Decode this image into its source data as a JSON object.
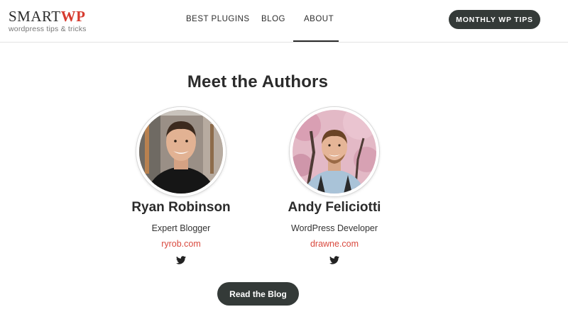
{
  "header": {
    "logo_main": "SMART",
    "logo_accent": "WP",
    "logo_tagline": "wordpress tips & tricks",
    "nav": [
      {
        "label": "BEST PLUGINS"
      },
      {
        "label": "BLOG"
      },
      {
        "label": "ABOUT"
      }
    ],
    "active_nav": "ABOUT",
    "tips_button": "MONTHLY WP TIPS"
  },
  "main": {
    "title": "Meet the Authors",
    "authors": [
      {
        "name": "Ryan Robinson",
        "role": "Expert Blogger",
        "link": "ryrob.com",
        "social_icon": "twitter-icon"
      },
      {
        "name": "Andy Feliciotti",
        "role": "WordPress Developer",
        "link": "drawne.com",
        "social_icon": "twitter-icon"
      }
    ],
    "read_button": "Read the Blog"
  },
  "colors": {
    "accent": "#d9493e",
    "dark_button": "#343a38",
    "text": "#2b2b2b"
  }
}
